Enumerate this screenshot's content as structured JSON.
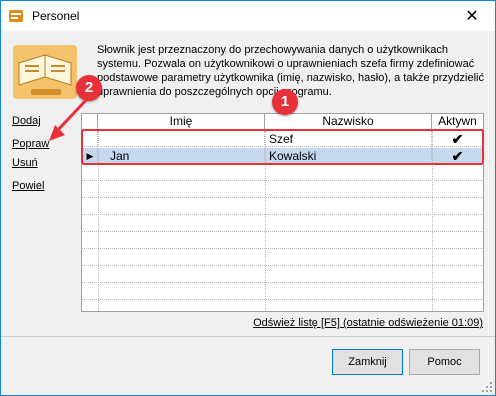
{
  "window": {
    "title": "Personel",
    "close_glyph": "✕"
  },
  "description": "Słownik jest przeznaczony do przechowywania danych o użytkownikach systemu. Pozwala on użytkownikowi o uprawnieniach szefa firmy zdefiniować podstawowe parametry użytkownika (imię, nazwisko, hasło), a także przydzielić uprawnienia do poszczególnych opcji programu.",
  "sidebar": {
    "items": [
      {
        "label": "Dodaj"
      },
      {
        "label": "Popraw"
      },
      {
        "label": "Usuń"
      },
      {
        "label": "Powiel"
      }
    ]
  },
  "table": {
    "columns": [
      "Imię",
      "Nazwisko",
      "Aktywn"
    ],
    "rows": [
      {
        "first": "",
        "last": "Szef",
        "active": "✔"
      },
      {
        "first": "Jan",
        "last": "Kowalski",
        "active": "✔",
        "selected": true
      }
    ]
  },
  "refresh_link": "Odśwież listę [F5] (ostatnie odświeżenie 01:09)",
  "buttons": {
    "close": "Zamknij",
    "help": "Pomoc"
  },
  "annotations": {
    "badge1": "1",
    "badge2": "2",
    "color": "#e8303a"
  },
  "row_indicator": "▶",
  "icons": [
    "app-icon",
    "book-icon",
    "close-icon",
    "resize-grip-icon"
  ]
}
